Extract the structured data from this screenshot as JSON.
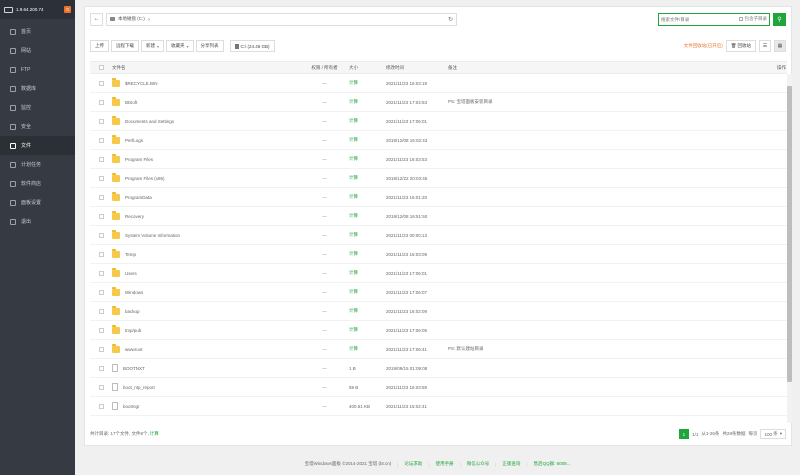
{
  "sidebar": {
    "ip": "1.9.64.200.74",
    "badge": "0",
    "items": [
      {
        "label": "首页",
        "active": false
      },
      {
        "label": "网站",
        "active": false
      },
      {
        "label": "FTP",
        "active": false
      },
      {
        "label": "数据库",
        "active": false
      },
      {
        "label": "监控",
        "active": false
      },
      {
        "label": "安全",
        "active": false
      },
      {
        "label": "文件",
        "active": true
      },
      {
        "label": "计划任务",
        "active": false
      },
      {
        "label": "软件商店",
        "active": false
      },
      {
        "label": "面板设置",
        "active": false
      },
      {
        "label": "退出",
        "active": false
      }
    ]
  },
  "path_bar": {
    "path": "本地磁盘 (C:)",
    "separator": ">",
    "search_placeholder": "搜索文件/目录",
    "search_subdir_label": "包含子目录"
  },
  "toolbar": {
    "upload": "上传",
    "remote_download": "远程下载",
    "new": "新建",
    "favorites": "收藏夹",
    "share_list": "分享列表",
    "disk": "C:\\ (24.46 GB)",
    "recycle_tip": "文件回收站(已开启)",
    "recycle": "回收站"
  },
  "table": {
    "headers": {
      "name": "文件名",
      "perm": "权限 / 所有者",
      "size": "大小",
      "date": "修改时间",
      "note": "备注",
      "op": "操作"
    },
    "rows": [
      {
        "name": "$RECYCLE.BIN",
        "type": "folder",
        "perm": "---",
        "size": "计算",
        "date": "2021/11/23 16:03:19",
        "note": ""
      },
      {
        "name": "BtSoft",
        "type": "folder",
        "perm": "---",
        "size": "计算",
        "date": "2021/11/23 17:04:53",
        "note": "PS: 宝塔面板安装目录"
      },
      {
        "name": "Documents and Settings",
        "type": "folder",
        "perm": "---",
        "size": "计算",
        "date": "2021/11/23 17:06:01",
        "note": ""
      },
      {
        "name": "PerfLogs",
        "type": "folder",
        "perm": "---",
        "size": "计算",
        "date": "2019/12/08 16:02:43",
        "note": ""
      },
      {
        "name": "Program Files",
        "type": "folder",
        "perm": "---",
        "size": "计算",
        "date": "2021/11/23 16:03:53",
        "note": ""
      },
      {
        "name": "Program Files (x86)",
        "type": "folder",
        "perm": "---",
        "size": "计算",
        "date": "2019/12/22 20:03:46",
        "note": ""
      },
      {
        "name": "ProgramData",
        "type": "folder",
        "perm": "---",
        "size": "计算",
        "date": "2021/11/23 16:01:20",
        "note": ""
      },
      {
        "name": "Recovery",
        "type": "folder",
        "perm": "---",
        "size": "计算",
        "date": "2019/12/08 16:51:50",
        "note": ""
      },
      {
        "name": "System Volume Information",
        "type": "folder",
        "perm": "---",
        "size": "计算",
        "date": "2021/11/23 00:00:13",
        "note": ""
      },
      {
        "name": "Temp",
        "type": "folder",
        "perm": "---",
        "size": "计算",
        "date": "2021/11/23 16:03:09",
        "note": ""
      },
      {
        "name": "Users",
        "type": "folder",
        "perm": "---",
        "size": "计算",
        "date": "2021/11/23 17:06:01",
        "note": ""
      },
      {
        "name": "Windows",
        "type": "folder",
        "perm": "---",
        "size": "计算",
        "date": "2021/11/23 17:06:07",
        "note": ""
      },
      {
        "name": "backup",
        "type": "folder",
        "perm": "---",
        "size": "计算",
        "date": "2021/11/23 16:02:09",
        "note": ""
      },
      {
        "name": "tmp/pub",
        "type": "folder",
        "perm": "---",
        "size": "计算",
        "date": "2021/11/23 17:06:05",
        "note": ""
      },
      {
        "name": "wwwroot",
        "type": "folder",
        "perm": "---",
        "size": "计算",
        "date": "2021/11/23 17:06:41",
        "note": "PS: 默认建站目录"
      },
      {
        "name": "BOOTNXT",
        "type": "file",
        "perm": "---",
        "size": "1 B",
        "date": "2019/09/15 01:09:08",
        "note": ""
      },
      {
        "name": "boot_ntp_report",
        "type": "file",
        "perm": "---",
        "size": "59 B",
        "date": "2021/11/23 16:03:59",
        "note": ""
      },
      {
        "name": "bootmgr",
        "type": "file",
        "perm": "---",
        "size": "400.51 KB",
        "date": "2021/11/23 15:02:41",
        "note": ""
      }
    ]
  },
  "footer": {
    "stats": "共计目录: 17个文件, 文件8个,",
    "stats_link": "计算",
    "current_page": "1",
    "page_text": "1/1",
    "range": "从1-26条",
    "total": "共28条数据",
    "per_page_label": "每页",
    "per_page": "100",
    "per_page_unit": "条"
  },
  "page_footer": {
    "copyright": "宝塔Windows面板 ©2014-2021 宝塔 (bt.cn)",
    "links": [
      "论坛求助",
      "使用手册",
      "微信公众号",
      "正版查询",
      "售后QQ群: 6008..."
    ]
  }
}
